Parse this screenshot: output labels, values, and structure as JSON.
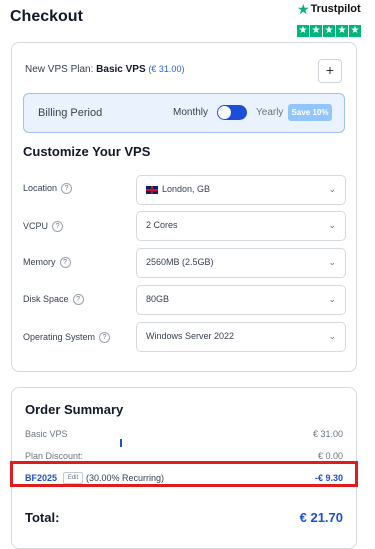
{
  "header": {
    "title": "Checkout"
  },
  "trustpilot": {
    "name": "Trustpilot",
    "stars": 5,
    "accent": "#00b67a"
  },
  "plan": {
    "prefix": "New VPS Plan:",
    "name": "Basic VPS",
    "price": "(€ 31.00)",
    "add_label": "+"
  },
  "billing": {
    "label": "Billing Period",
    "monthly": "Monthly",
    "yearly": "Yearly",
    "save_badge": "Save 10%",
    "toggle_on": true
  },
  "customize": {
    "title": "Customize Your VPS",
    "fields": [
      {
        "label": "Location",
        "value": "London, GB"
      },
      {
        "label": "VCPU",
        "value": "2 Cores"
      },
      {
        "label": "Memory",
        "value": "2560MB (2.5GB)"
      },
      {
        "label": "Disk Space",
        "value": "80GB"
      },
      {
        "label": "Operating System",
        "value": "Windows Server 2022"
      }
    ]
  },
  "summary": {
    "title": "Order Summary",
    "basic_label": "Basic VPS",
    "basic_value": "€ 31.00",
    "discount_label": "Plan Discount:",
    "discount_value": "€ 0.00",
    "coupon_code": "BF2025",
    "coupon_edit": "Edit",
    "coupon_desc": "(30.00% Recurring)",
    "coupon_value": "-€ 9.30",
    "total_label": "Total:",
    "total_value": "€ 21.70"
  },
  "colors": {
    "accent": "#1d4ed8",
    "highlight": "#e01c1c",
    "billing_bg": "#e9f2fd"
  }
}
